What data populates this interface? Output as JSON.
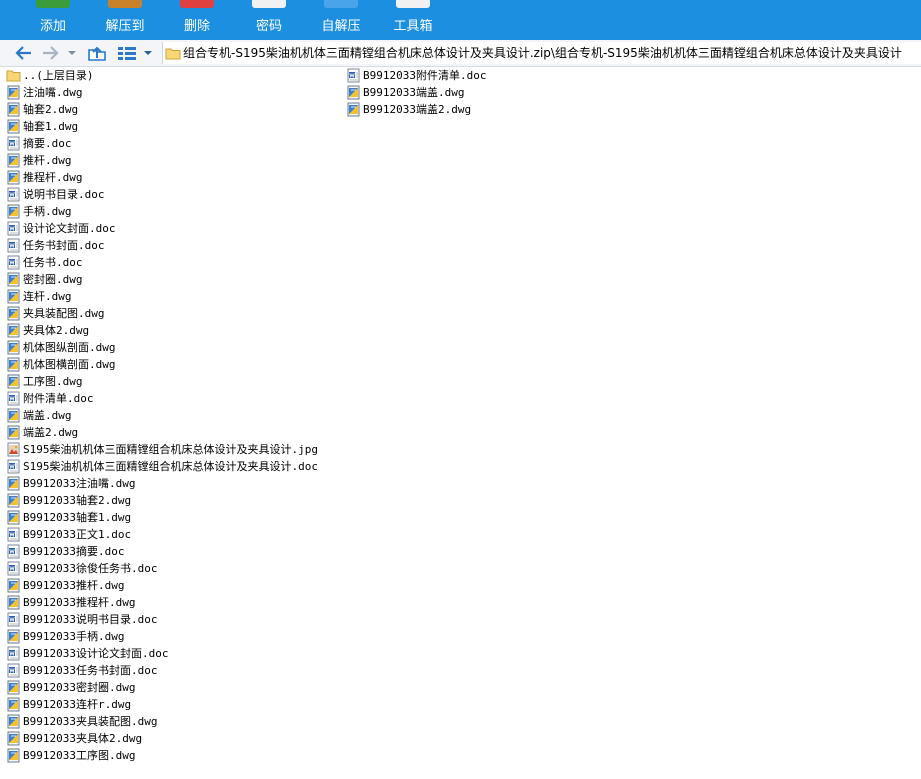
{
  "toolbar": {
    "items": [
      {
        "label": "添加",
        "icon": "add-icon",
        "color": "#3a9d3a"
      },
      {
        "label": "解压到",
        "icon": "extract-to-icon",
        "color": "#c9822a"
      },
      {
        "label": "删除",
        "icon": "delete-icon",
        "color": "#e04040"
      },
      {
        "label": "密码",
        "icon": "password-icon",
        "color": "#f1f1f1"
      },
      {
        "label": "自解压",
        "icon": "self-extract-icon",
        "color": "#4aa4ea"
      },
      {
        "label": "工具箱",
        "icon": "toolbox-icon",
        "color": "#f1f1f1"
      }
    ]
  },
  "address": {
    "path": "组合专机-S195柴油机机体三面精镗组合机床总体设计及夹具设计.zip\\组合专机-S195柴油机机体三面精镗组合机床总体设计及夹具设计"
  },
  "files": {
    "column1": [
      {
        "name": "..(上层目录)",
        "type": "up"
      },
      {
        "name": "注油嘴.dwg",
        "type": "dwg"
      },
      {
        "name": "轴套2.dwg",
        "type": "dwg"
      },
      {
        "name": "轴套1.dwg",
        "type": "dwg"
      },
      {
        "name": "摘要.doc",
        "type": "doc"
      },
      {
        "name": "推杆.dwg",
        "type": "dwg"
      },
      {
        "name": "推程杆.dwg",
        "type": "dwg"
      },
      {
        "name": "说明书目录.doc",
        "type": "doc"
      },
      {
        "name": "手柄.dwg",
        "type": "dwg"
      },
      {
        "name": "设计论文封面.doc",
        "type": "doc"
      },
      {
        "name": "任务书封面.doc",
        "type": "doc"
      },
      {
        "name": "任务书.doc",
        "type": "doc"
      },
      {
        "name": "密封圈.dwg",
        "type": "dwg"
      },
      {
        "name": "连杆.dwg",
        "type": "dwg"
      },
      {
        "name": "夹具装配图.dwg",
        "type": "dwg"
      },
      {
        "name": "夹具体2.dwg",
        "type": "dwg"
      },
      {
        "name": "机体图纵剖面.dwg",
        "type": "dwg"
      },
      {
        "name": "机体图横剖面.dwg",
        "type": "dwg"
      },
      {
        "name": "工序图.dwg",
        "type": "dwg"
      },
      {
        "name": "附件清单.doc",
        "type": "doc"
      },
      {
        "name": "端盖.dwg",
        "type": "dwg"
      },
      {
        "name": "端盖2.dwg",
        "type": "dwg"
      },
      {
        "name": "S195柴油机机体三面精镗组合机床总体设计及夹具设计.jpg",
        "type": "jpg"
      },
      {
        "name": "S195柴油机机体三面精镗组合机床总体设计及夹具设计.doc",
        "type": "doc"
      },
      {
        "name": "B9912033注油嘴.dwg",
        "type": "dwg"
      },
      {
        "name": "B9912033轴套2.dwg",
        "type": "dwg"
      },
      {
        "name": "B9912033轴套1.dwg",
        "type": "dwg"
      },
      {
        "name": "B9912033正文1.doc",
        "type": "doc"
      },
      {
        "name": "B9912033摘要.doc",
        "type": "doc"
      },
      {
        "name": "B9912033徐俊任务书.doc",
        "type": "doc"
      },
      {
        "name": "B9912033推杆.dwg",
        "type": "dwg"
      },
      {
        "name": "B9912033推程杆.dwg",
        "type": "dwg"
      },
      {
        "name": "B9912033说明书目录.doc",
        "type": "doc"
      },
      {
        "name": "B9912033手柄.dwg",
        "type": "dwg"
      },
      {
        "name": "B9912033设计论文封面.doc",
        "type": "doc"
      },
      {
        "name": "B9912033任务书封面.doc",
        "type": "doc"
      },
      {
        "name": "B9912033密封圈.dwg",
        "type": "dwg"
      },
      {
        "name": "B9912033连杆r.dwg",
        "type": "dwg"
      },
      {
        "name": "B9912033夹具装配图.dwg",
        "type": "dwg"
      },
      {
        "name": "B9912033夹具体2.dwg",
        "type": "dwg"
      },
      {
        "name": "B9912033工序图.dwg",
        "type": "dwg"
      }
    ],
    "column2": [
      {
        "name": "B9912033附件清单.doc",
        "type": "doc"
      },
      {
        "name": "B9912033端盖.dwg",
        "type": "dwg"
      },
      {
        "name": "B9912033端盖2.dwg",
        "type": "dwg"
      }
    ]
  }
}
